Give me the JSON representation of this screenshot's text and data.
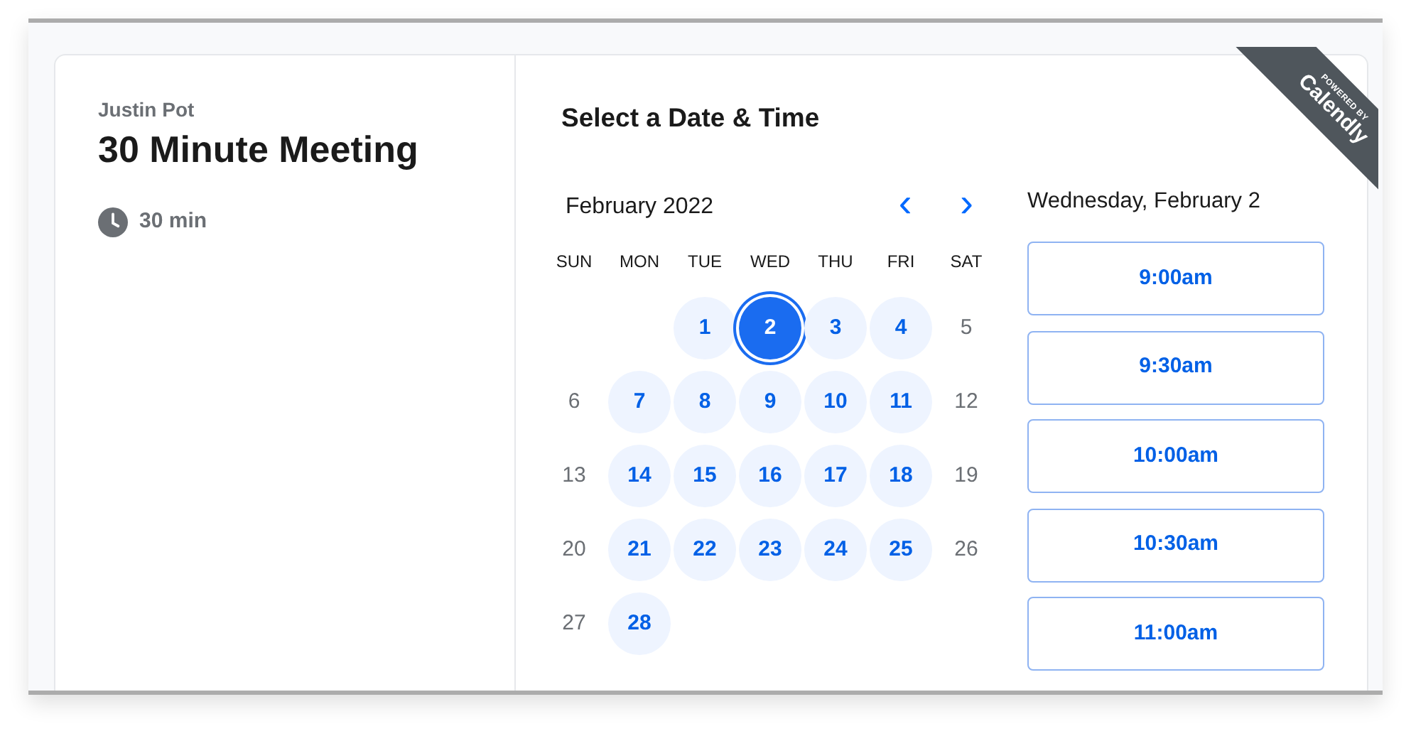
{
  "host": {
    "name": "Justin Pot",
    "event_title": "30 Minute Meeting",
    "duration": "30 min"
  },
  "ribbon": {
    "line_1": "POWERED BY",
    "line_2": "Calendly"
  },
  "scheduler": {
    "title": "Select a Date & Time",
    "month": "February 2022",
    "prev_button": "‹",
    "next_button": "›",
    "weekdays": [
      "SUN",
      "MON",
      "TUE",
      "WED",
      "THU",
      "FRI",
      "SAT"
    ],
    "weeks": [
      {
        "kind": "lead",
        "days": [
          {
            "day": "1",
            "available": true,
            "selected": false
          },
          {
            "day": "2",
            "available": true,
            "selected": true
          },
          {
            "day": "3",
            "available": true,
            "selected": false
          },
          {
            "day": "4",
            "available": true,
            "selected": false
          },
          {
            "day": "5",
            "available": false,
            "selected": false
          }
        ]
      },
      {
        "kind": "full",
        "days": [
          {
            "day": "6",
            "available": false,
            "selected": false
          },
          {
            "day": "7",
            "available": true,
            "selected": false
          },
          {
            "day": "8",
            "available": true,
            "selected": false
          },
          {
            "day": "9",
            "available": true,
            "selected": false
          },
          {
            "day": "10",
            "available": true,
            "selected": false
          },
          {
            "day": "11",
            "available": true,
            "selected": false
          },
          {
            "day": "12",
            "available": false,
            "selected": false
          }
        ]
      },
      {
        "kind": "full",
        "days": [
          {
            "day": "13",
            "available": false,
            "selected": false
          },
          {
            "day": "14",
            "available": true,
            "selected": false
          },
          {
            "day": "15",
            "available": true,
            "selected": false
          },
          {
            "day": "16",
            "available": true,
            "selected": false
          },
          {
            "day": "17",
            "available": true,
            "selected": false
          },
          {
            "day": "18",
            "available": true,
            "selected": false
          },
          {
            "day": "19",
            "available": false,
            "selected": false
          }
        ]
      },
      {
        "kind": "full",
        "days": [
          {
            "day": "20",
            "available": false,
            "selected": false
          },
          {
            "day": "21",
            "available": true,
            "selected": false
          },
          {
            "day": "22",
            "available": true,
            "selected": false
          },
          {
            "day": "23",
            "available": true,
            "selected": false
          },
          {
            "day": "24",
            "available": true,
            "selected": false
          },
          {
            "day": "25",
            "available": true,
            "selected": false
          },
          {
            "day": "26",
            "available": false,
            "selected": false
          }
        ]
      },
      {
        "kind": "tail",
        "days": [
          {
            "day": "27",
            "available": false,
            "selected": false
          },
          {
            "day": "28",
            "available": true,
            "selected": false
          }
        ]
      }
    ],
    "selected_date": "Wednesday, February 2",
    "time_slots": [
      "9:00am",
      "9:30am",
      "10:00am",
      "10:30am",
      "11:00am"
    ]
  }
}
